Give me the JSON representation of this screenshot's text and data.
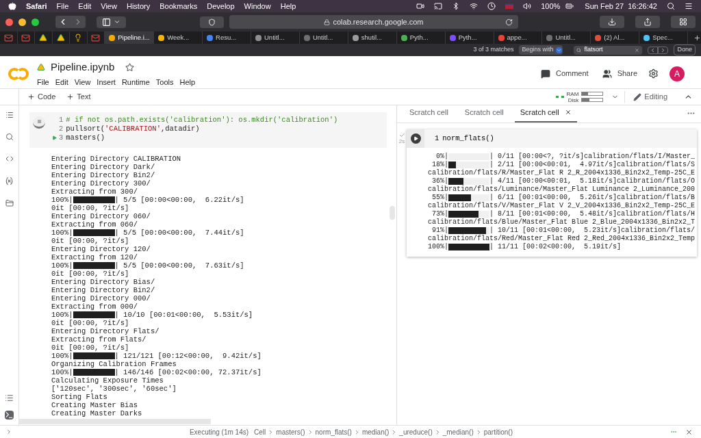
{
  "menu_bar": {
    "app": "Safari",
    "items": [
      "File",
      "Edit",
      "View",
      "History",
      "Bookmarks",
      "Develop",
      "Window",
      "Help"
    ],
    "battery": "100%",
    "date": "Sun Feb 27",
    "time": "16:26:42"
  },
  "browser": {
    "url": "colab.research.google.com",
    "pinned": [
      {
        "kind": "mail"
      },
      {
        "kind": "mail"
      },
      {
        "kind": "drive"
      },
      {
        "kind": "drive"
      },
      {
        "kind": "bulb"
      },
      {
        "kind": "mail"
      }
    ],
    "tabs": [
      {
        "label": "Pipeline.i...",
        "selected": true,
        "color": "#f9ab00"
      },
      {
        "label": "Week...",
        "selected": false,
        "color": "#f4b400"
      },
      {
        "label": "Resu...",
        "selected": false,
        "color": "#4285f4"
      },
      {
        "label": "Untitl...",
        "selected": false,
        "color": "#8e8e93"
      },
      {
        "label": "Untitl...",
        "selected": false,
        "color": "#6e6e73"
      },
      {
        "label": "shutil...",
        "selected": false,
        "color": "#9a9a9f"
      },
      {
        "label": "Pyth...",
        "selected": false,
        "color": "#4caf50"
      },
      {
        "label": "Pyth...",
        "selected": false,
        "color": "#7c4dff"
      },
      {
        "label": "appe...",
        "selected": false,
        "color": "#ea4335"
      },
      {
        "label": "Untitl...",
        "selected": false,
        "color": "#6e6e73"
      },
      {
        "label": "(2) Al...",
        "selected": false,
        "color": "#e04e39"
      },
      {
        "label": "Spec...",
        "selected": false,
        "color": "#4fc3f7"
      }
    ],
    "find": {
      "matches": "3 of 3 matches",
      "mode": "Begins with",
      "value": "flatsort",
      "done": "Done"
    }
  },
  "notebook": {
    "title": "Pipeline.ipynb",
    "menu": [
      "File",
      "Edit",
      "View",
      "Insert",
      "Runtime",
      "Tools",
      "Help"
    ],
    "comment": "Comment",
    "share": "Share",
    "avatar": "A",
    "add_code": "Code",
    "add_text": "Text",
    "ram": {
      "label": "RAM",
      "level": 0.3
    },
    "disk": {
      "label": "Disk",
      "level": 0.35
    },
    "mode": "Editing"
  },
  "cell": {
    "running": true,
    "lines": [
      {
        "number": "1",
        "current": false,
        "tokens": [
          {
            "kind": "comment",
            "text": "# if not os.path.exists('calibration'): os.mkdir('calibration')"
          }
        ]
      },
      {
        "number": "2",
        "current": false,
        "tokens": [
          {
            "kind": "plain",
            "text": "pullsort("
          },
          {
            "kind": "string",
            "text": "'CALIBRATION'"
          },
          {
            "kind": "plain",
            "text": ",datadir)"
          }
        ]
      },
      {
        "number": "3",
        "current": true,
        "tokens": [
          {
            "kind": "plain",
            "text": "masters()"
          }
        ]
      }
    ],
    "output": [
      {
        "kind": "text",
        "text": "Entering Directory CALIBRATION"
      },
      {
        "kind": "text",
        "text": "Entering Directory Dark/"
      },
      {
        "kind": "text",
        "text": "Entering Directory Bin2/"
      },
      {
        "kind": "text",
        "text": "Entering Directory 300/"
      },
      {
        "kind": "text",
        "text": "Extracting from 300/"
      },
      {
        "kind": "progress",
        "percent": "100%|",
        "level": 1,
        "detail": "| 5/5 [00:00<00:00,  6.22it/s]"
      },
      {
        "kind": "text",
        "text": "0it [00:00, ?it/s]"
      },
      {
        "kind": "text",
        "text": "Entering Directory 060/"
      },
      {
        "kind": "text",
        "text": "Extracting from 060/"
      },
      {
        "kind": "progress",
        "percent": "100%|",
        "level": 1,
        "detail": "| 5/5 [00:00<00:00,  7.44it/s]"
      },
      {
        "kind": "text",
        "text": "0it [00:00, ?it/s]"
      },
      {
        "kind": "text",
        "text": "Entering Directory 120/"
      },
      {
        "kind": "text",
        "text": "Extracting from 120/"
      },
      {
        "kind": "progress",
        "percent": "100%|",
        "level": 1,
        "detail": "| 5/5 [00:00<00:00,  7.63it/s]"
      },
      {
        "kind": "text",
        "text": "0it [00:00, ?it/s]"
      },
      {
        "kind": "text",
        "text": "Entering Directory Bias/"
      },
      {
        "kind": "text",
        "text": "Entering Directory Bin2/"
      },
      {
        "kind": "text",
        "text": "Entering Directory 000/"
      },
      {
        "kind": "text",
        "text": "Extracting from 000/"
      },
      {
        "kind": "progress",
        "percent": "100%|",
        "level": 1,
        "detail": "| 10/10 [00:01<00:00,  5.53it/s]"
      },
      {
        "kind": "text",
        "text": "0it [00:00, ?it/s]"
      },
      {
        "kind": "text",
        "text": "Entering Directory Flats/"
      },
      {
        "kind": "text",
        "text": "Extracting from Flats/"
      },
      {
        "kind": "text",
        "text": "0it [00:00, ?it/s]"
      },
      {
        "kind": "progress",
        "percent": "100%|",
        "level": 1,
        "detail": "| 121/121 [00:12<00:00,  9.42it/s]"
      },
      {
        "kind": "text",
        "text": "Organizing Calibration Frames"
      },
      {
        "kind": "progress",
        "percent": "100%|",
        "level": 1,
        "detail": "| 146/146 [00:02<00:00, 72.37it/s]"
      },
      {
        "kind": "text",
        "text": "Calculating Exposure Times"
      },
      {
        "kind": "text",
        "text": "['120sec', '300sec', '60sec']"
      },
      {
        "kind": "text",
        "text": "Sorting Flats"
      },
      {
        "kind": "text",
        "text": "Creating Master Bias"
      },
      {
        "kind": "text",
        "text": "Creating Master Darks"
      }
    ]
  },
  "scratch": {
    "tabs": [
      {
        "label": "Scratch cell",
        "selected": false
      },
      {
        "label": "Scratch cell",
        "selected": false
      },
      {
        "label": "Scratch cell",
        "selected": true
      }
    ],
    "done": true,
    "elapsed": "2s",
    "code": {
      "number": "1",
      "text": "norm_flats()"
    },
    "output": [
      {
        "kind": "progress",
        "percent": "  0%|",
        "level": 0,
        "detail": "| 0/11 [00:00<?, ?it/s]calibration/flats/I/Master_"
      },
      {
        "kind": "progress",
        "percent": " 18%|",
        "level": 0.18,
        "detail": "| 2/11 [00:00<00:01,  4.97it/s]calibration/flats/S"
      },
      {
        "kind": "text",
        "text": "calibration/flats/R/Master_Flat R 2_R_2004x1336_Bin2x2_Temp-25C_E"
      },
      {
        "kind": "progress",
        "percent": " 36%|",
        "level": 0.36,
        "detail": "| 4/11 [00:00<00:01,  5.18it/s]calibration/flats/O"
      },
      {
        "kind": "text",
        "text": "calibration/flats/Luminance/Master_Flat Luminance 2_Luminance_200"
      },
      {
        "kind": "progress",
        "percent": " 55%|",
        "level": 0.55,
        "detail": "| 6/11 [00:01<00:00,  5.26it/s]calibration/flats/B"
      },
      {
        "kind": "text",
        "text": "calibration/flats/V/Master_Flat V 2_V_2004x1336_Bin2x2_Temp-25C_E"
      },
      {
        "kind": "progress",
        "percent": " 73%|",
        "level": 0.73,
        "detail": "| 8/11 [00:01<00:00,  5.48it/s]calibration/flats/H"
      },
      {
        "kind": "text",
        "text": "calibration/flats/Blue/Master_Flat Blue 2_Blue_2004x1336_Bin2x2_T"
      },
      {
        "kind": "progress",
        "percent": " 91%|",
        "level": 0.91,
        "detail": "| 10/11 [00:01<00:00,  5.23it/s]calibration/flats/"
      },
      {
        "kind": "text",
        "text": "calibration/flats/Red/Master_Flat Red 2_Red_2004x1336_Bin2x2_Temp"
      },
      {
        "kind": "progress",
        "percent": "100%|",
        "level": 1,
        "detail": "| 11/11 [00:02<00:00,  5.19it/s]"
      }
    ]
  },
  "status_bar": {
    "executing": "Executing (1m 14s)",
    "cell": "Cell",
    "path": [
      "masters()",
      "norm_flats()",
      "median()",
      "_ureduce()",
      "_median()",
      "partition()"
    ]
  }
}
